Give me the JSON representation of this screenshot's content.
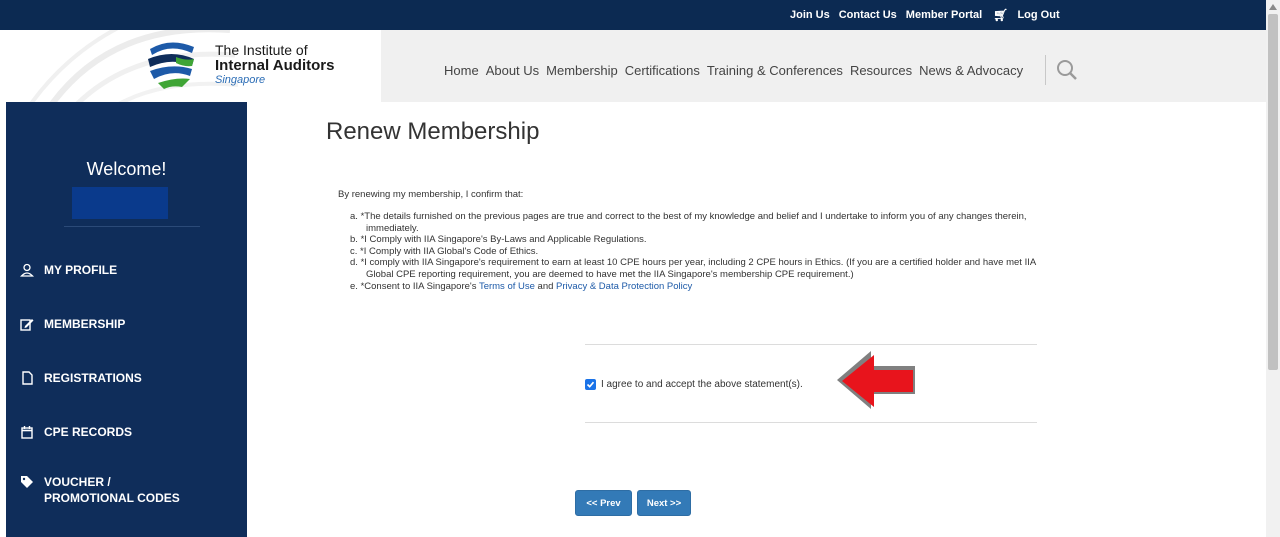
{
  "topbar": {
    "links": [
      "Join Us",
      "Contact Us",
      "Member Portal",
      "Log Out"
    ]
  },
  "logo": {
    "line1": "The Institute of",
    "line2": "Internal Auditors",
    "line3": "Singapore"
  },
  "nav": {
    "items": [
      "Home",
      "About Us",
      "Membership",
      "Certifications",
      "Training & Conferences",
      "Resources",
      "News & Advocacy"
    ]
  },
  "sidebar": {
    "welcome": "Welcome!",
    "items": [
      {
        "label": "MY PROFILE",
        "icon": "user-icon"
      },
      {
        "label": "MEMBERSHIP",
        "icon": "edit-icon"
      },
      {
        "label": "REGISTRATIONS",
        "icon": "file-icon"
      },
      {
        "label": "CPE RECORDS",
        "icon": "calendar-icon"
      },
      {
        "label": "VOUCHER /",
        "label2": "PROMOTIONAL CODES",
        "icon": "tag-icon"
      }
    ]
  },
  "main": {
    "title": "Renew Membership",
    "intro": "By renewing my membership, I confirm that:",
    "terms": [
      {
        "marker": "a.",
        "text": "*The details furnished on the previous pages are true and correct to the best of my knowledge and belief and I undertake to inform you of any changes therein, immediately."
      },
      {
        "marker": "b.",
        "text": "*I Comply with IIA Singapore's By-Laws and Applicable Regulations."
      },
      {
        "marker": "c.",
        "text": "*I Comply with IIA Global's Code of Ethics."
      },
      {
        "marker": "d.",
        "text": "*I comply with IIA Singapore's requirement to earn at least 10 CPE hours per year, including 2 CPE hours in Ethics. (If you are a certified holder and have met IIA Global CPE reporting requirement, you are deemed to have met the IIA Singapore's membership CPE requirement.)"
      },
      {
        "marker": "e.",
        "text": "*Consent to IIA Singapore's ",
        "link1": "Terms of Use",
        "mid": " and ",
        "link2": "Privacy & Data Protection Policy"
      }
    ],
    "agree_label": "I agree to and accept the above statement(s).",
    "agree_checked": true,
    "prev_label": "<< Prev",
    "next_label": "Next >>"
  },
  "colors": {
    "navy": "#0c2a52",
    "sidebar": "#0f2d5a",
    "button": "#337ab7",
    "arrow": "#e8141c"
  }
}
